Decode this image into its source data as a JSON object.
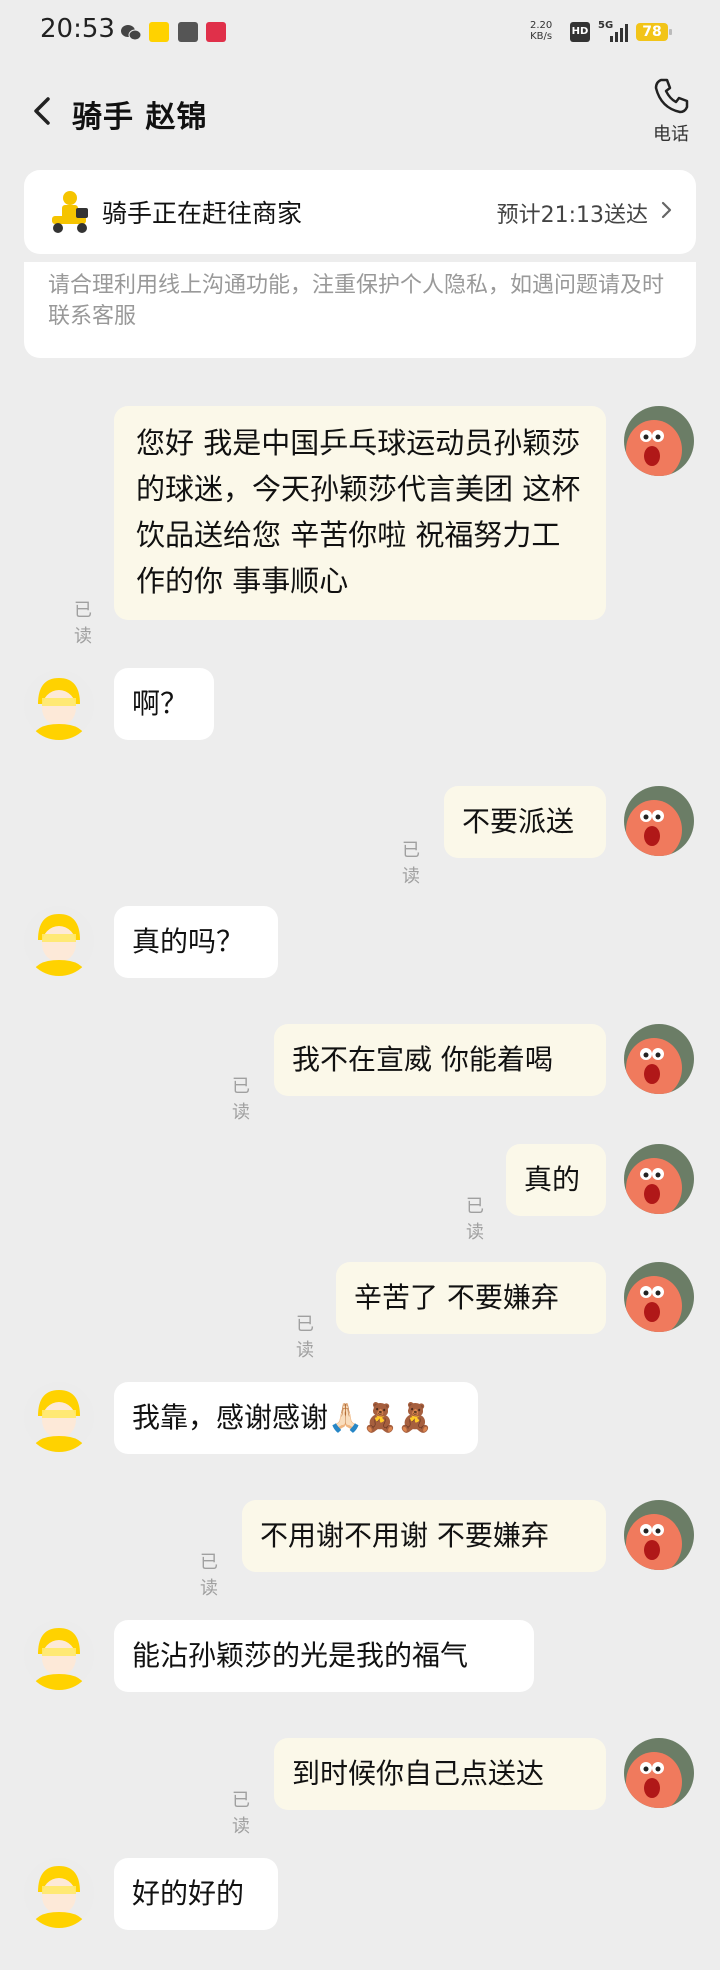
{
  "status_bar": {
    "time": "20:53",
    "net_speed_value": "2.20",
    "net_speed_unit": "KB/s",
    "hd": "HD",
    "signal": "5G",
    "battery": "78"
  },
  "header": {
    "title": "骑手 赵锦",
    "call_label": "电话"
  },
  "order_status": {
    "title": "骑手正在赶往商家",
    "eta": "预计21:13送达"
  },
  "notice": "请合理利用线上沟通功能，注重保护个人隐私，如遇问题请及时联系客服",
  "read_label": "已读",
  "messages": [
    {
      "from": "me",
      "text": "您好 我是中国乒乓球运动员孙颖莎的球迷，今天孙颖莎代言美团 这杯饮品送给您  辛苦你啦 祝福努力工作的你 事事顺心",
      "read": "已读"
    },
    {
      "from": "rider",
      "text": "啊？"
    },
    {
      "from": "me",
      "text": "不要派送",
      "read": "已读"
    },
    {
      "from": "rider",
      "text": "真的吗？"
    },
    {
      "from": "me",
      "text": "我不在宣威 你能着喝",
      "read": "已读"
    },
    {
      "from": "me",
      "text": "真的",
      "read": "已读"
    },
    {
      "from": "me",
      "text": "辛苦了 不要嫌弃",
      "read": "已读"
    },
    {
      "from": "rider",
      "text": "我靠，感谢感谢🙏🏻🧸🧸"
    },
    {
      "from": "me",
      "text": "不用谢不用谢 不要嫌弃",
      "read": "已读"
    },
    {
      "from": "rider",
      "text": "能沾孙颖莎的光是我的福气"
    },
    {
      "from": "me",
      "text": "到时候你自己点送达",
      "read": "已读"
    },
    {
      "from": "rider",
      "text": "好的好的"
    }
  ],
  "colors": {
    "background": "#ededed",
    "my_bubble": "#fbf8e9",
    "rider_bubble": "#ffffff",
    "accent_yellow": "#ffd200"
  }
}
